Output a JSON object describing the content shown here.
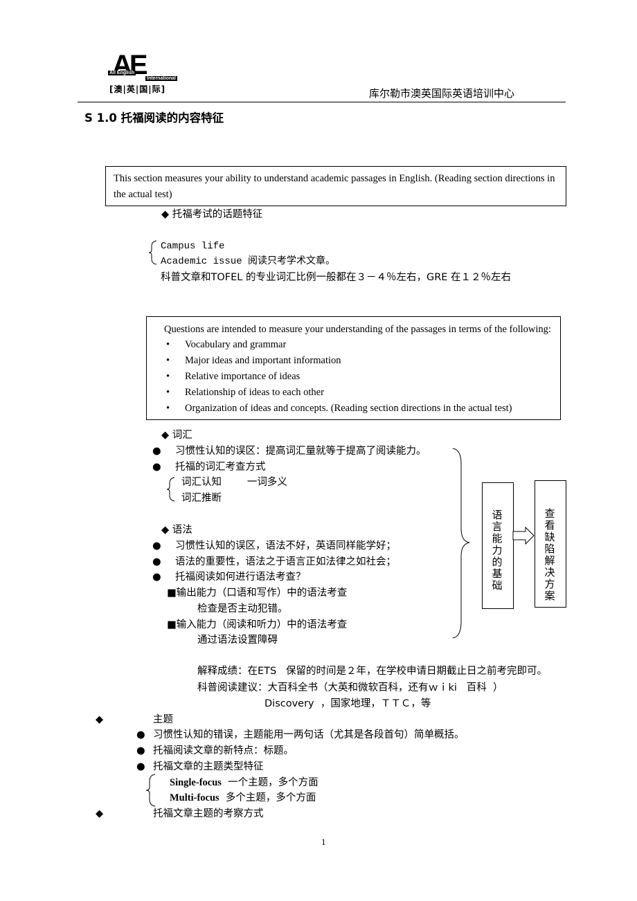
{
  "header": {
    "logo_text": "AE",
    "logo_sub1": "All English",
    "logo_sub2": "International",
    "logo_cn": "[澳|英|国|际]",
    "org_name": "库尔勒市澳英国际英语培训中心"
  },
  "title": "S 1.0 托福阅读的内容特征",
  "box1": {
    "line1": "This section measures your ability to understand academic passages in English. (Reading section directions in",
    "line2": "the actual test)"
  },
  "topic_heading": "◆ 托福考试的话题特征",
  "topics": [
    "Campus life",
    "Academic issue  阅读只考学术文章。"
  ],
  "vocab_ratio": "科普文章和TOFEL 的专业词汇比例一般都在３－４％左右，GRE 在１２％左右",
  "box2": {
    "intro": "Questions are intended to measure your understanding of the passages in terms of the following:",
    "bullets": [
      "Vocabulary and grammar",
      "Major ideas and important information",
      "Relative importance of ideas",
      "Relationship of ideas to each other",
      "Organization of ideas and concepts. (Reading section directions in the actual test)"
    ]
  },
  "vocab": {
    "heading": "◆ 词汇",
    "items": [
      "习惯性认知的误区：提高词汇量就等于提高了阅读能力。",
      "托福的词汇考查方式"
    ],
    "sub1": "词汇认知        一词多义",
    "sub2": "词汇推断"
  },
  "grammar": {
    "heading": "◆ 语法",
    "items": [
      "习惯性认知的误区，语法不好，英语同样能学好；",
      "语法的重要性，语法之于语言正如法律之如社会；",
      "托福阅读如何进行语法考查？"
    ],
    "output": "■输出能力（口语和写作）中的语法考查",
    "output_note": "检查是否主动犯错。",
    "input": "■输入能力（阅读和听力）中的语法考查",
    "input_note": "通过语法设置障碍"
  },
  "diagram": {
    "box_a": "语言能力的基础",
    "box_b": "查看缺陷解决方案"
  },
  "notes": {
    "scores": "解释成绩：在ETS   保留的时间是２年，在学校申请日期截止日之前考完即可。",
    "reading": "科普阅读建议：大百科全书（大英和微软百科，还有ｗｉki   百科  ）",
    "reading2": "Discovery  ，国家地理，ＴＴＣ，等"
  },
  "theme": {
    "heading": "主题",
    "items": [
      "习惯性认知的错误，主题能用一两句话（尤其是各段首句）简单概括。",
      "托福阅读文章的新特点：标题。",
      "托福文章的主题类型特征"
    ],
    "single_label": "Single-focus",
    "single_text": "  一个主题，多个方面",
    "multi_label": "Multi-focus",
    "multi_text": "  多个主题，多个方面",
    "heading2": "托福文章主题的考察方式"
  },
  "page_number": "1"
}
